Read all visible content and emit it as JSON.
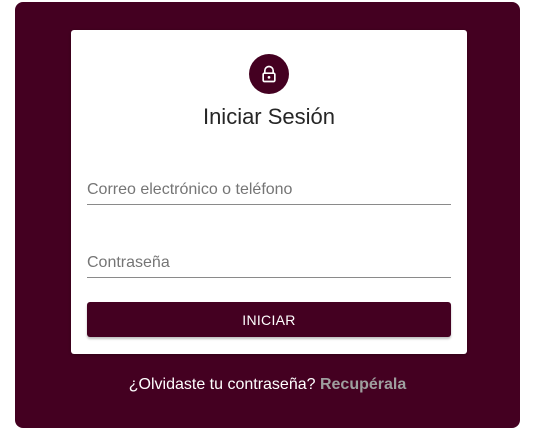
{
  "login": {
    "title": "Iniciar Sesión",
    "icon": "lock-icon",
    "email_placeholder": "Correo electrónico o teléfono",
    "email_value": "",
    "password_placeholder": "Contraseña",
    "password_value": "",
    "submit_label": "INICIAR"
  },
  "footer": {
    "question": "¿Olvidaste tu contraseña?",
    "link": "Recupérala"
  },
  "colors": {
    "brand": "#440021",
    "card": "#ffffff",
    "link": "#9e9e9e"
  }
}
